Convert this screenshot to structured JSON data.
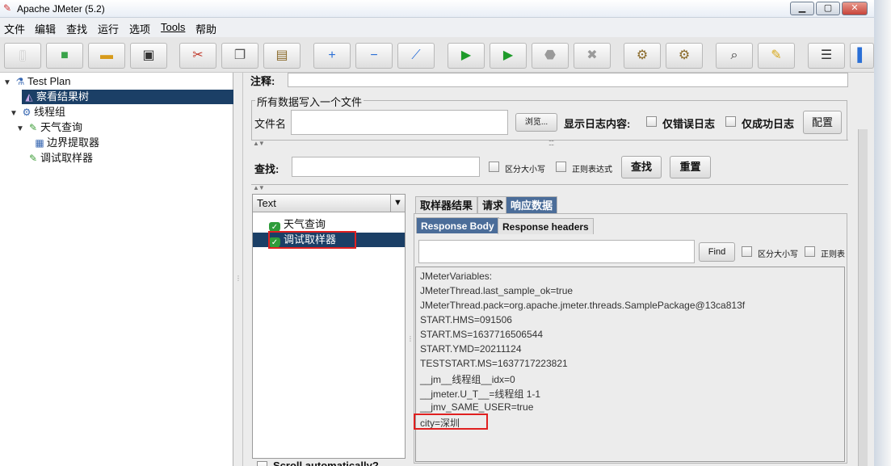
{
  "window": {
    "title": "Apache JMeter (5.2)",
    "controls": [
      "▁",
      "▢",
      "✕"
    ]
  },
  "menu": [
    "文件",
    "编辑",
    "查找",
    "运行",
    "选项",
    "Tools",
    "帮助"
  ],
  "toolbar": {
    "buttons": [
      {
        "name": "new-plan-icon",
        "glyph": "▯",
        "color": "#ffffff"
      },
      {
        "name": "templates-icon",
        "glyph": "■",
        "color": "#3aa34a"
      },
      {
        "name": "open-icon",
        "glyph": "▬",
        "color": "#d79b1b"
      },
      {
        "name": "save-icon",
        "glyph": "▣",
        "color": "#333333"
      },
      {
        "name": "cut-icon",
        "glyph": "✂",
        "color": "#c0392b"
      },
      {
        "name": "copy-icon",
        "glyph": "❐",
        "color": "#555555"
      },
      {
        "name": "paste-icon",
        "glyph": "▤",
        "color": "#8a6a2a"
      },
      {
        "name": "expand-icon",
        "glyph": "+",
        "color": "#2a6fd6"
      },
      {
        "name": "collapse-icon",
        "glyph": "−",
        "color": "#2a6fd6"
      },
      {
        "name": "toggle-icon",
        "glyph": "⟋",
        "color": "#2a6fd6"
      },
      {
        "name": "start-icon",
        "glyph": "▶",
        "color": "#1e9b2a"
      },
      {
        "name": "start-no-timers-icon",
        "glyph": "▶",
        "color": "#1e9b2a"
      },
      {
        "name": "stop-icon",
        "glyph": "⬣",
        "color": "#9a9a9a"
      },
      {
        "name": "shutdown-icon",
        "glyph": "✖",
        "color": "#9a9a9a"
      },
      {
        "name": "clear-icon",
        "glyph": "⚙",
        "color": "#8a6a2a"
      },
      {
        "name": "clear-all-icon",
        "glyph": "⚙",
        "color": "#8a6a2a"
      },
      {
        "name": "search-icon",
        "glyph": "⌕",
        "color": "#333333"
      },
      {
        "name": "reset-search-icon",
        "glyph": "✎",
        "color": "#d7a81b"
      },
      {
        "name": "function-helper-icon",
        "glyph": "☰",
        "color": "#333333"
      },
      {
        "name": "help-icon",
        "glyph": "▌",
        "color": "#2a6fd6"
      }
    ]
  },
  "tree": {
    "items": [
      {
        "label": "Test Plan",
        "expander": "▼",
        "icon": "⚗",
        "icon_name": "test-plan-icon",
        "selected": false
      },
      {
        "label": "察看结果树",
        "expander": "",
        "icon": "◭",
        "icon_name": "listener-icon",
        "selected": true
      },
      {
        "label": "线程组",
        "expander": "▼",
        "icon": "⚙",
        "icon_name": "thread-group-icon",
        "selected": false
      },
      {
        "label": "天气查询",
        "expander": "▼",
        "icon": "✎",
        "icon_name": "sampler-icon",
        "selected": false
      },
      {
        "label": "边界提取器",
        "expander": "",
        "icon": "▦",
        "icon_name": "extractor-icon",
        "selected": false
      },
      {
        "label": "调试取样器",
        "expander": "",
        "icon": "✎",
        "icon_name": "debug-sampler-icon",
        "selected": false
      }
    ]
  },
  "comment": {
    "label": "注释:",
    "value": ""
  },
  "file_group": {
    "legend": "所有数据写入一个文件",
    "filename_label": "文件名",
    "filename_value": "",
    "browse_label": "浏览...",
    "log_label": "显示日志内容:",
    "errors_only_label": "仅错误日志",
    "success_only_label": "仅成功日志",
    "config_label": "配置"
  },
  "search_bar": {
    "label": "查找:",
    "value": "",
    "case_label": "区分大小写",
    "regex_label": "正则表达式",
    "find_label": "查找",
    "reset_label": "重置"
  },
  "results": {
    "renderer": "Text",
    "items": [
      {
        "label": "天气查询",
        "selected": false
      },
      {
        "label": "调试取样器",
        "selected": true
      }
    ],
    "scroll_label": "Scroll automatically?"
  },
  "detail_tabs": [
    {
      "label": "取样器结果",
      "active": false
    },
    {
      "label": "请求",
      "active": false
    },
    {
      "label": "响应数据",
      "active": true
    }
  ],
  "response_tabs": [
    {
      "label": "Response Body",
      "active": true
    },
    {
      "label": "Response headers",
      "active": false
    }
  ],
  "body_search": {
    "value": "",
    "find_label": "Find",
    "case_label": "区分大小写",
    "regex_label": "正则表"
  },
  "response_lines": [
    "JMeterVariables:",
    "JMeterThread.last_sample_ok=true",
    "JMeterThread.pack=org.apache.jmeter.threads.SamplePackage@13ca813f",
    "START.HMS=091506",
    "START.MS=1637716506544",
    "START.YMD=20211124",
    "TESTSTART.MS=1637717223821",
    "__jm__线程组__idx=0",
    "__jmeter.U_T__=线程组 1-1",
    "__jmv_SAME_USER=true",
    "city=深圳"
  ],
  "colors": {
    "selection": "#1b3f66",
    "active_tab": "#4b6d99",
    "highlight_box": "#e02020",
    "ok_icon": "#2e9c3a"
  }
}
